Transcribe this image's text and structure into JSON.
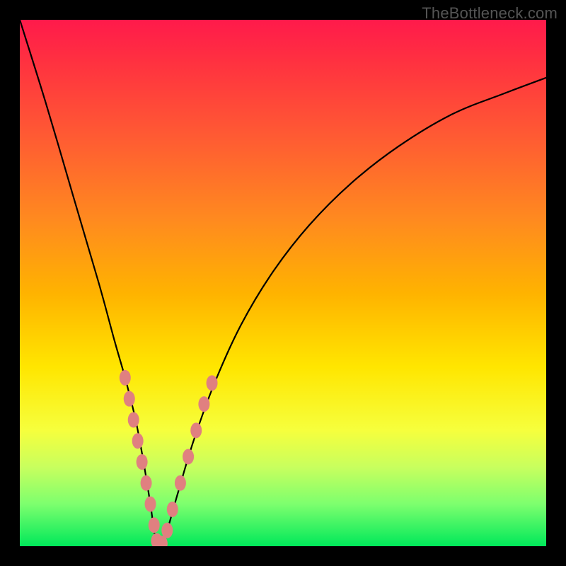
{
  "watermark": "TheBottleneck.com",
  "chart_data": {
    "type": "line",
    "title": "",
    "xlabel": "",
    "ylabel": "",
    "xlim": [
      0,
      100
    ],
    "ylim": [
      0,
      100
    ],
    "grid": false,
    "legend": null,
    "x": [
      0,
      5,
      10,
      15,
      18,
      20,
      22,
      23.5,
      24.8,
      25.5,
      26,
      26.5,
      27,
      28,
      30,
      33,
      37,
      42,
      48,
      55,
      63,
      72,
      82,
      92,
      100
    ],
    "series": [
      {
        "name": "bottleneck-curve",
        "values": [
          100,
          84,
          67,
          50,
          39,
          32,
          24,
          16,
          8,
          3,
          0.5,
          0,
          0.5,
          3,
          10,
          20,
          31,
          42,
          52,
          61,
          69,
          76,
          82,
          86,
          89
        ]
      }
    ],
    "markers": {
      "name": "highlight-points",
      "points": [
        {
          "x": 20.0,
          "y": 32
        },
        {
          "x": 20.8,
          "y": 28
        },
        {
          "x": 21.6,
          "y": 24
        },
        {
          "x": 22.4,
          "y": 20
        },
        {
          "x": 23.2,
          "y": 16
        },
        {
          "x": 24.0,
          "y": 12
        },
        {
          "x": 24.8,
          "y": 8
        },
        {
          "x": 25.5,
          "y": 4
        },
        {
          "x": 26.0,
          "y": 1
        },
        {
          "x": 26.5,
          "y": 0
        },
        {
          "x": 27.0,
          "y": 0.5
        },
        {
          "x": 28.0,
          "y": 3
        },
        {
          "x": 29.0,
          "y": 7
        },
        {
          "x": 30.5,
          "y": 12
        },
        {
          "x": 32.0,
          "y": 17
        },
        {
          "x": 33.5,
          "y": 22
        },
        {
          "x": 35.0,
          "y": 27
        },
        {
          "x": 36.5,
          "y": 31
        }
      ]
    }
  }
}
